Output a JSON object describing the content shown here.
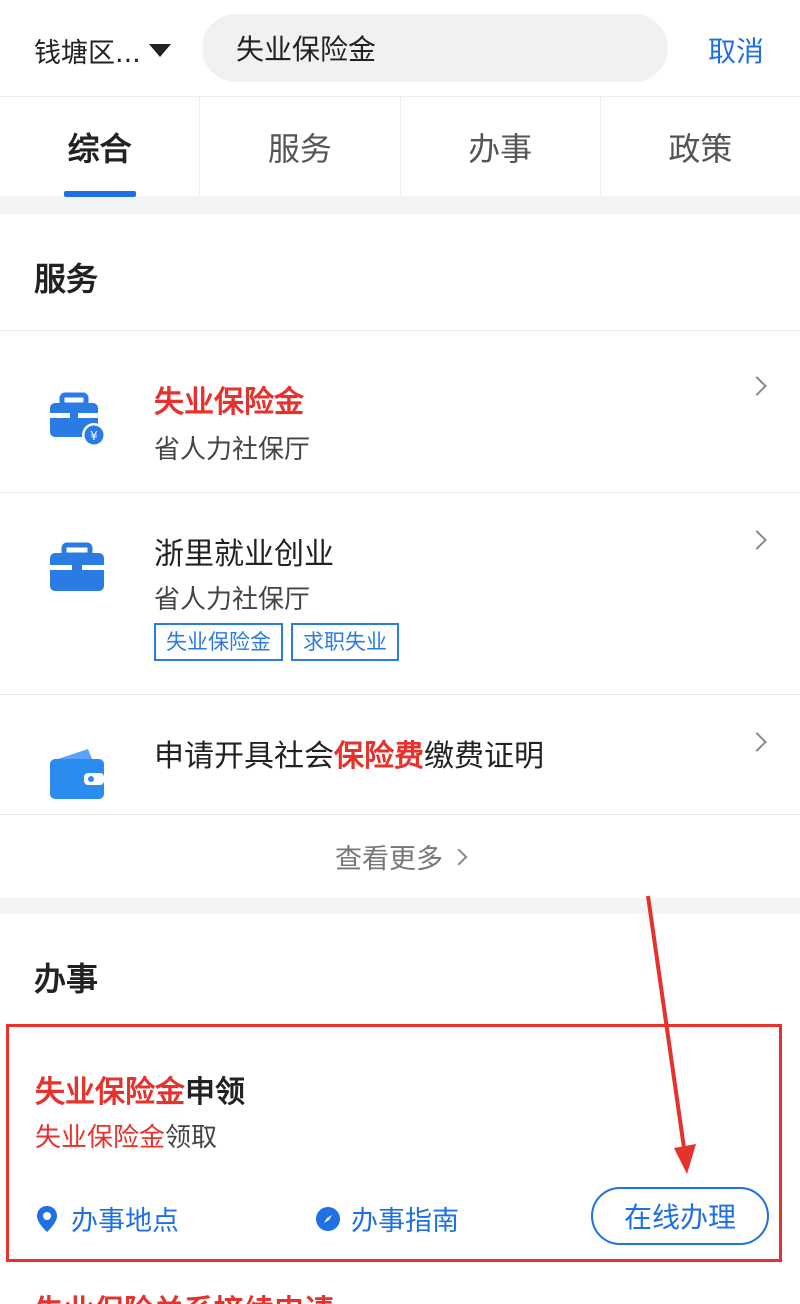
{
  "header": {
    "region": "钱塘区...",
    "search_value": "失业保险金",
    "cancel": "取消"
  },
  "tabs": [
    {
      "label": "综合",
      "active": true
    },
    {
      "label": "服务",
      "active": false
    },
    {
      "label": "办事",
      "active": false
    },
    {
      "label": "政策",
      "active": false
    }
  ],
  "services": {
    "title": "服务",
    "items": [
      {
        "title": "失业保险金",
        "provider": "省人力社保厅",
        "icon": "toolbox-yuan-icon"
      },
      {
        "title": "浙里就业创业",
        "provider": "省人力社保厅",
        "tags": [
          "失业保险金",
          "求职失业"
        ],
        "icon": "toolbox-icon"
      },
      {
        "title_pre": "申请开具社会",
        "title_hl": "保险费",
        "title_post": "缴费证明",
        "icon": "wallet-icon"
      }
    ],
    "more": "查看更多"
  },
  "affairs": {
    "title": "办事",
    "card": {
      "title_hl": "失业保险金",
      "title_post": "申领",
      "sub_hl": "失业保险金",
      "sub_post": "领取",
      "location": "办事地点",
      "guide": "办事指南",
      "online": "在线办理"
    },
    "next_item_peek": "失业保险关系接续申请"
  },
  "colors": {
    "accent": "#1f6fe5",
    "highlight": "#e5322d",
    "annotation_red": "#e5322d"
  }
}
